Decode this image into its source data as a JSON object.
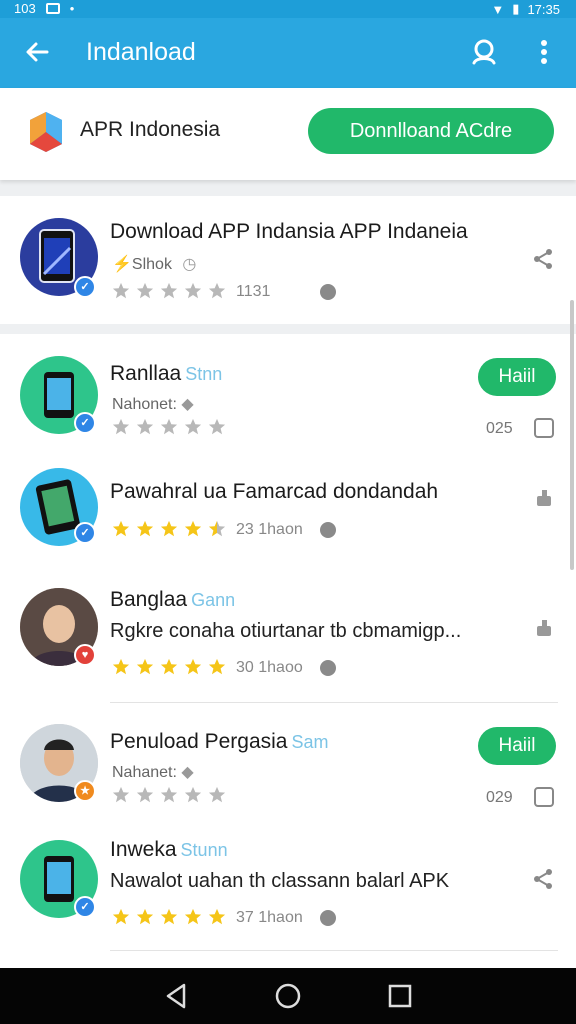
{
  "status_bar": {
    "left_text": "103",
    "time": "17:35"
  },
  "app_bar": {
    "title": "Indanload"
  },
  "header": {
    "brand": "APR Indonesia",
    "download_button": "Donnlloand ACdre"
  },
  "featured": {
    "title": "Download APP Indansia APP Indaneia",
    "subtitle": "Slhok",
    "rating": 0,
    "count": "1131"
  },
  "items": [
    {
      "title": "Ranllaa",
      "tag": "Stnn",
      "subtitle": "Nahonet:",
      "rating": 0,
      "action": "Haiil",
      "count": "025"
    },
    {
      "title": "Pawahral ua Famarcad dondandah",
      "tag": "",
      "rating": 4.5,
      "meta": "23 1haon"
    },
    {
      "title": "Banglaa",
      "tag": "Gann",
      "desc": "Rgkre conaha otiurtanar tb cbmamigp...",
      "rating": 5,
      "meta": "30 1haoo"
    },
    {
      "title": "Penuload Pergasia",
      "tag": "Sam",
      "subtitle": "Nahanet:",
      "rating": 0,
      "action": "Haiil",
      "count": "029"
    },
    {
      "title": "Inweka",
      "tag": "Stunn",
      "desc": "Nawalot uahan th classann balarl APK",
      "rating": 5,
      "meta": "37 1haon"
    }
  ],
  "colors": {
    "primary": "#2aa7e0",
    "accent_green": "#21b86a",
    "star_gold": "#f5c518"
  }
}
